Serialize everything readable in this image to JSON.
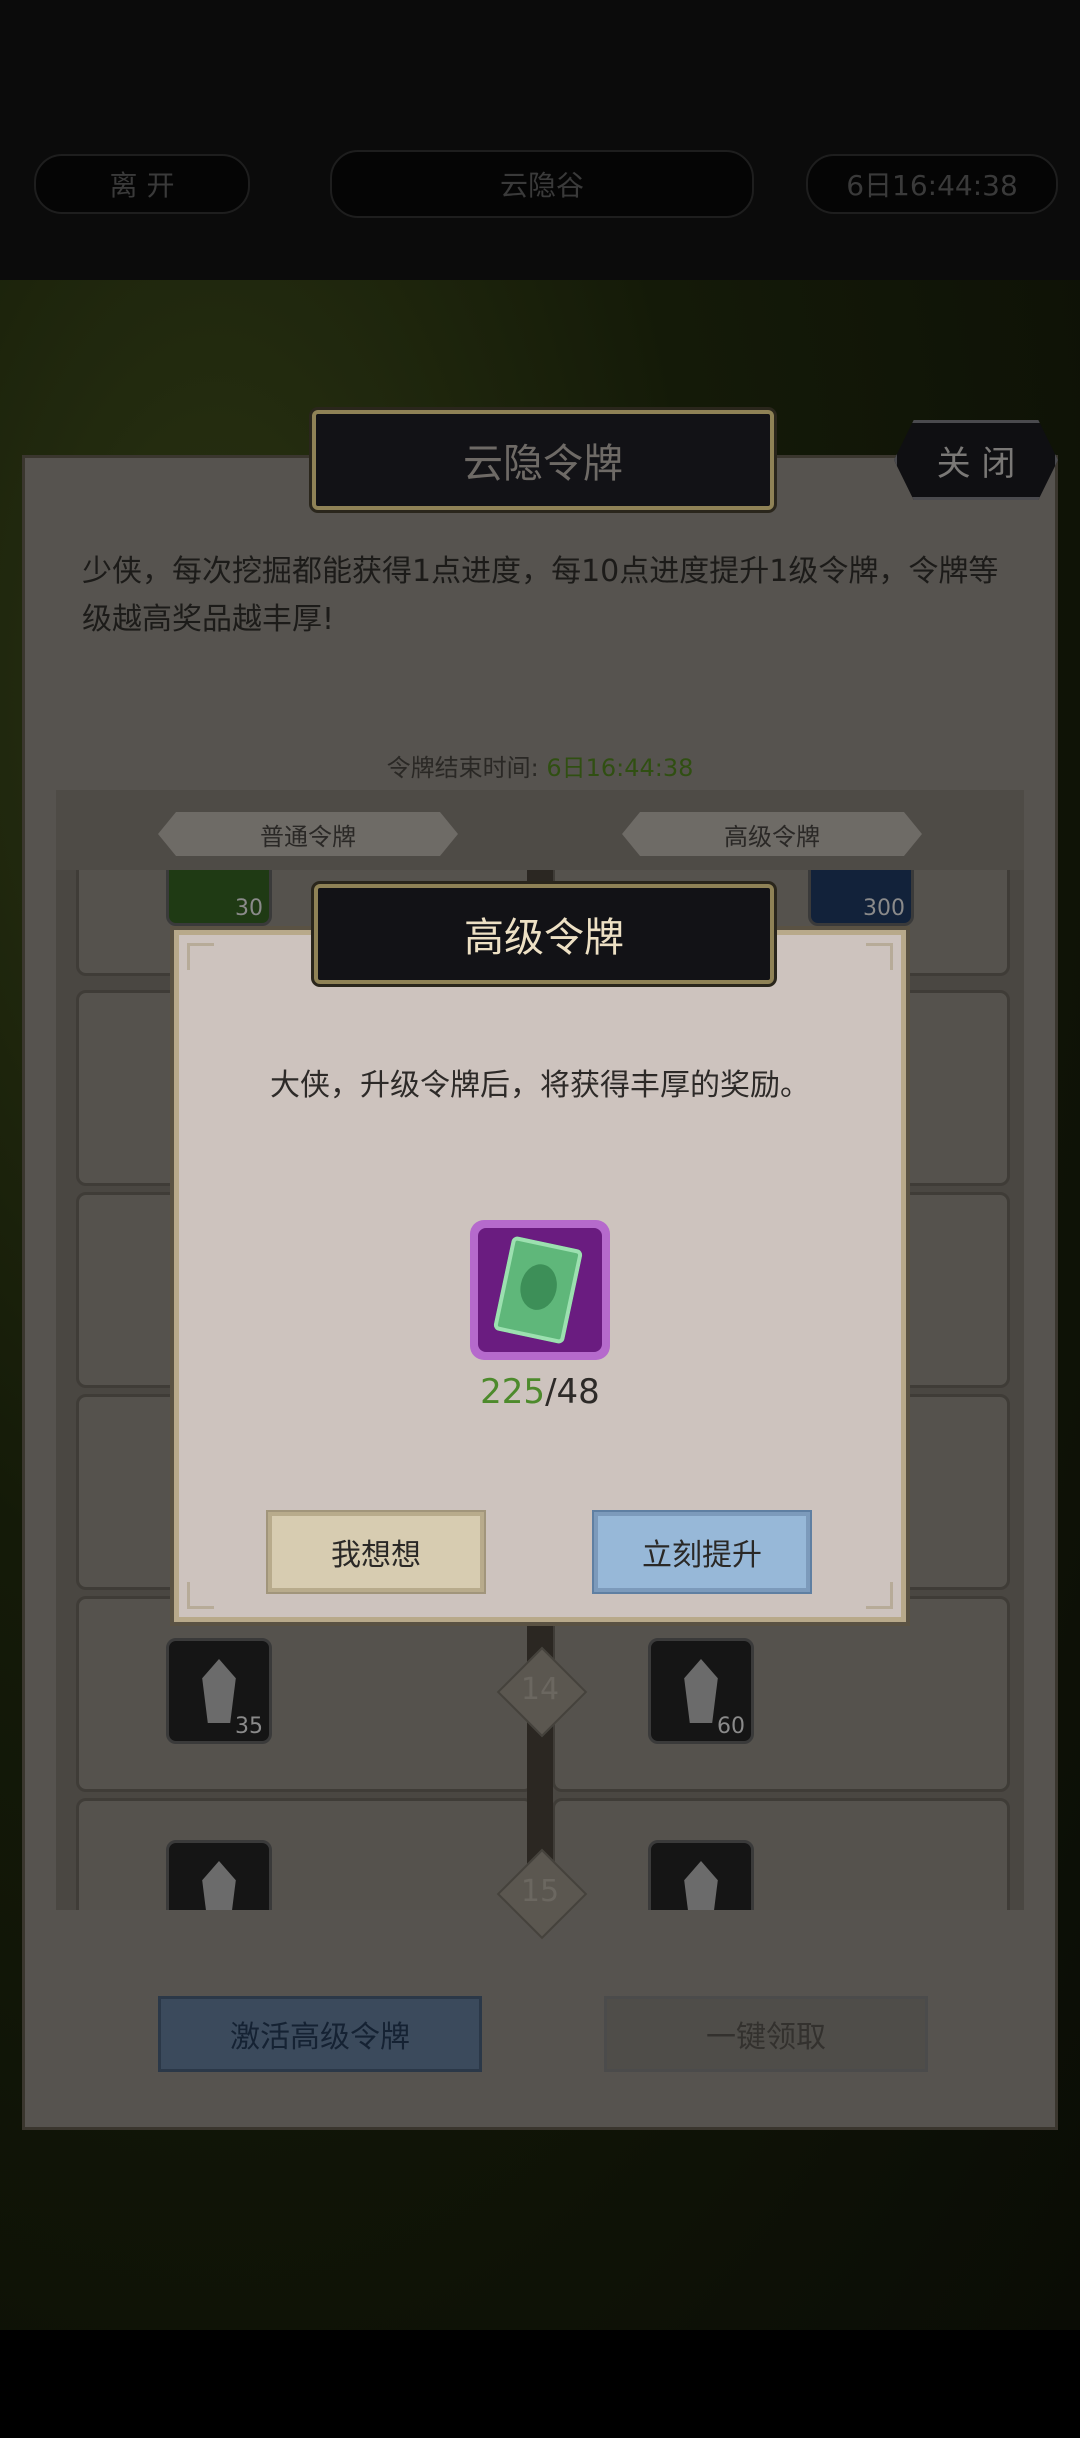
{
  "top": {
    "leave_label": "离 开",
    "location": "云隐谷",
    "timer": "6日16:44:38"
  },
  "panel": {
    "title": "云隐令牌",
    "close_label": "关 闭",
    "description": "少侠，每次挖掘都能获得1点进度，每10点进度提升1级令牌，令牌等级越高奖品越丰厚!",
    "end_time_label": "令牌结束时间:",
    "end_time_value": "6日16:44:38",
    "tabs": [
      "普通令牌",
      "高级令牌"
    ],
    "rows": [
      {
        "level": "",
        "normal_count": "30",
        "premium_count": "300"
      },
      {
        "level": "14",
        "normal_count": "35",
        "premium_count": "60"
      },
      {
        "level": "15",
        "normal_count": "",
        "premium_count": ""
      }
    ],
    "activate_label": "激活高级令牌",
    "claim_all_label": "一键领取"
  },
  "dialog": {
    "title": "高级令牌",
    "message": "大侠，升级令牌后，将获得丰厚的奖励。",
    "item_icon": "jade-token-icon",
    "have": "225",
    "sep": "/",
    "need": "48",
    "think_label": "我想想",
    "upgrade_label": "立刻提升"
  },
  "colors": {
    "have_green": "#4d8a2c",
    "upgrade_blue": "#97b8d8",
    "think_beige": "#d7ccb1"
  }
}
